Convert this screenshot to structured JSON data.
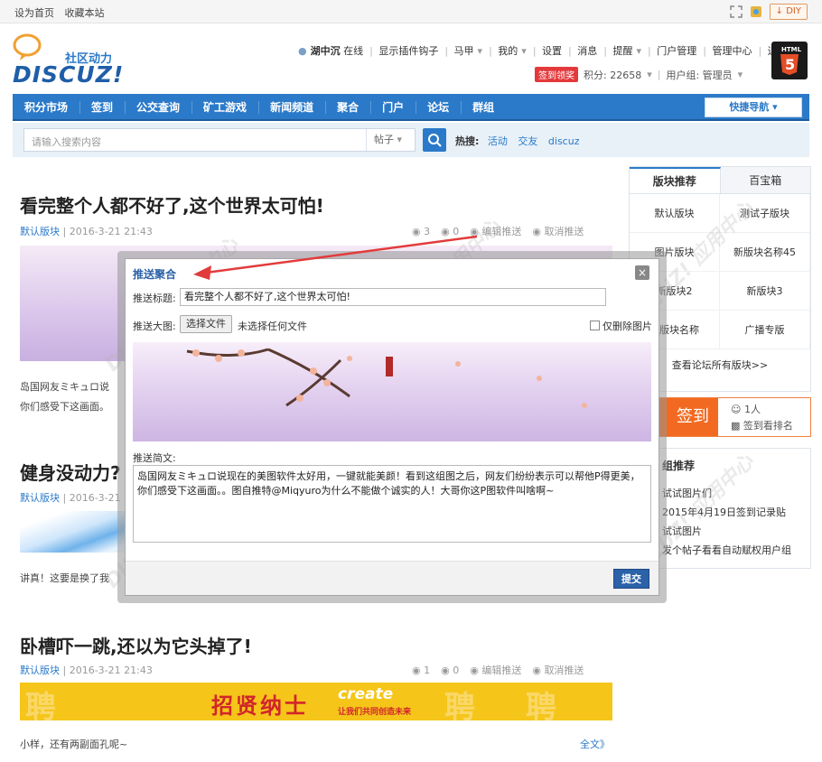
{
  "topbar": {
    "set_home": "设为首页",
    "bookmark": "收藏本站",
    "diy": "DIY"
  },
  "logo": {
    "tagline": "社区动力",
    "brand": "DISCUZ!"
  },
  "user": {
    "name": "湖中沉",
    "status": "在线",
    "links": [
      "显示插件钩子",
      "马甲",
      "我的",
      "设置",
      "消息",
      "提醒",
      "门户管理",
      "管理中心",
      "退出"
    ],
    "sign_badge": "签到领奖",
    "points": "积分: 22658",
    "group": "用户组: 管理员"
  },
  "nav": {
    "items": [
      "积分市场",
      "签到",
      "公交查询",
      "矿工游戏",
      "新闻频道",
      "聚合",
      "门户",
      "论坛",
      "群组"
    ],
    "quick": "快捷导航"
  },
  "search": {
    "placeholder": "请输入搜索内容",
    "scope": "帖子",
    "hot_label": "热搜:",
    "hot": [
      "活动",
      "交友",
      "discuz"
    ]
  },
  "posts": [
    {
      "title": "看完整个人都不好了,这个世界太可怕!",
      "block": "默认版块",
      "date": "2016-3-21 21:43",
      "views": "3",
      "replies": "0",
      "edit": "编辑推送",
      "cancel": "取消推送",
      "excerpt1": "岛国网友ミキュロ说",
      "excerpt2": "你们感受下这画面。"
    },
    {
      "title": "健身没动力?",
      "block": "默认版块",
      "date": "2016-3-21",
      "excerpt1": "讲真！这要是换了我"
    },
    {
      "title": "卧槽吓一跳,还以为它头掉了!",
      "block": "默认版块",
      "date": "2016-3-21 21:43",
      "views": "1",
      "replies": "0",
      "edit": "编辑推送",
      "cancel": "取消推送",
      "excerpt1": "小样，还有两副面孔呢~",
      "more": "全文》"
    }
  ],
  "banner": {
    "text": "招贤纳士",
    "en": "create",
    "sub": "让我们共同创造未来"
  },
  "sidebar": {
    "tabs": [
      "版块推荐",
      "百宝箱"
    ],
    "cells": [
      "默认版块",
      "测试子版块",
      "图片版块",
      "新版块名称45",
      "新版块2",
      "新版块3",
      "新版块名称",
      "广播专版"
    ],
    "foot": "查看论坛所有版块>>"
  },
  "sign": {
    "label": "签到",
    "people": "1人",
    "rank": "签到看排名"
  },
  "group": {
    "title": "组推荐",
    "items": [
      "试试图片们",
      "2015年4月19日签到记录贴",
      "试试图片",
      "发个帖子看看自动赋权用户组"
    ]
  },
  "dialog": {
    "title": "推送聚合",
    "title_label": "推送标题:",
    "title_value": "看完整个人都不好了,这个世界太可怕!",
    "image_label": "推送大图:",
    "choose_file": "选择文件",
    "no_file": "未选择任何文件",
    "delete_image": "仅删除图片",
    "summary_label": "推送简文:",
    "summary": "岛国网友ミキュロ说现在的美图软件太好用，一键就能美颜！看到这组图之后，网友们纷纷表示可以帮他P得更美，你们感受下这画面。。图自推特@Miqyuro为什么不能做个诚实的人！大哥你这P图软件叫啥啊~",
    "submit": "提交"
  },
  "colors": {
    "primary": "#2b7ac9",
    "accent": "#f26a21",
    "arrow": "#e23b3b"
  }
}
